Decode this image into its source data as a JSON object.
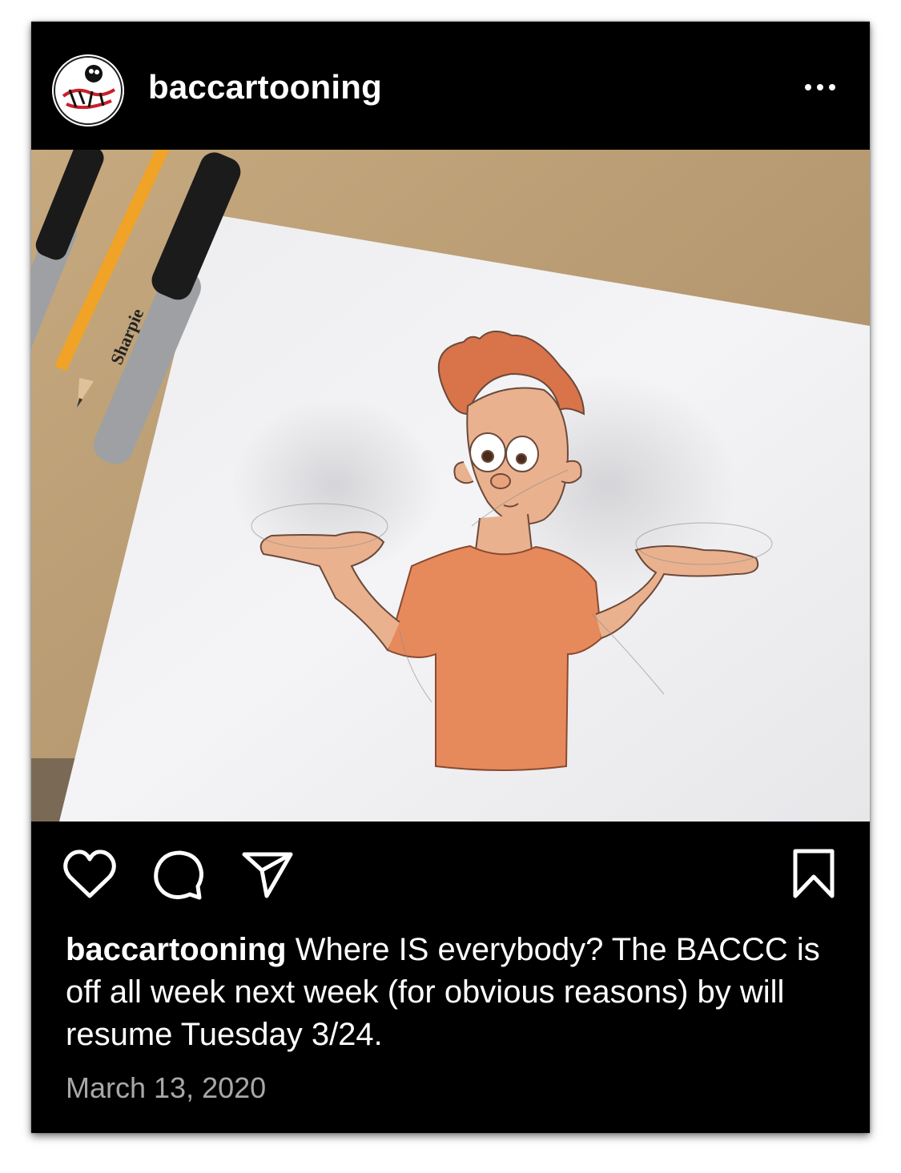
{
  "post": {
    "username": "baccartooning",
    "avatar_icon": "bacc-logo-icon",
    "more_icon": "more-options-icon",
    "image_description_icon": "drawing-photo",
    "actions": {
      "like_icon": "heart-icon",
      "comment_icon": "comment-icon",
      "share_icon": "send-icon",
      "save_icon": "bookmark-icon"
    },
    "caption": {
      "username": "baccartooning",
      "text": " Where IS everybody?  The BACCC is off all week next week (for obvious reasons) by will resume Tuesday 3/24."
    },
    "date": "March 13, 2020"
  },
  "colors": {
    "background": "#000000",
    "text": "#ffffff",
    "muted_text": "#a8a8a8",
    "brand_red": "#c8202a"
  }
}
